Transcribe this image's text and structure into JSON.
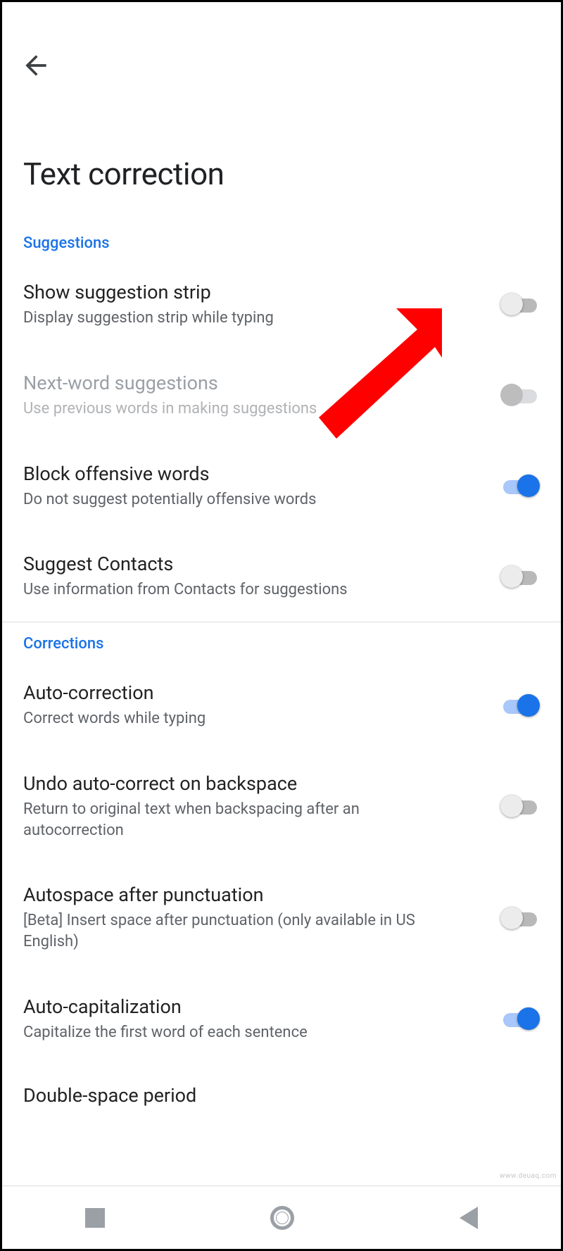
{
  "page": {
    "title": "Text correction"
  },
  "sections": {
    "suggestions": {
      "header": "Suggestions",
      "items": [
        {
          "key": "show-suggestion-strip",
          "label": "Show suggestion strip",
          "desc": "Display suggestion strip while typing",
          "on": false,
          "disabled": false
        },
        {
          "key": "next-word-suggestions",
          "label": "Next-word suggestions",
          "desc": "Use previous words in making suggestions",
          "on": false,
          "disabled": true
        },
        {
          "key": "block-offensive-words",
          "label": "Block offensive words",
          "desc": "Do not suggest potentially offensive words",
          "on": true,
          "disabled": false
        },
        {
          "key": "suggest-contacts",
          "label": "Suggest Contacts",
          "desc": "Use information from Contacts for suggestions",
          "on": false,
          "disabled": false
        }
      ]
    },
    "corrections": {
      "header": "Corrections",
      "items": [
        {
          "key": "auto-correction",
          "label": "Auto-correction",
          "desc": "Correct words while typing",
          "on": true,
          "disabled": false
        },
        {
          "key": "undo-auto-correct",
          "label": "Undo auto-correct on backspace",
          "desc": "Return to original text when backspacing after an autocorrection",
          "on": false,
          "disabled": false
        },
        {
          "key": "autospace-after-punctuation",
          "label": "Autospace after punctuation",
          "desc": "[Beta] Insert space after punctuation (only available in US English)",
          "on": false,
          "disabled": false
        },
        {
          "key": "auto-capitalization",
          "label": "Auto-capitalization",
          "desc": "Capitalize the first word of each sentence",
          "on": true,
          "disabled": false
        },
        {
          "key": "double-space-period",
          "label": "Double-space period",
          "desc": "",
          "on": true,
          "disabled": false
        }
      ]
    }
  },
  "watermark": "www.deuaq.com"
}
